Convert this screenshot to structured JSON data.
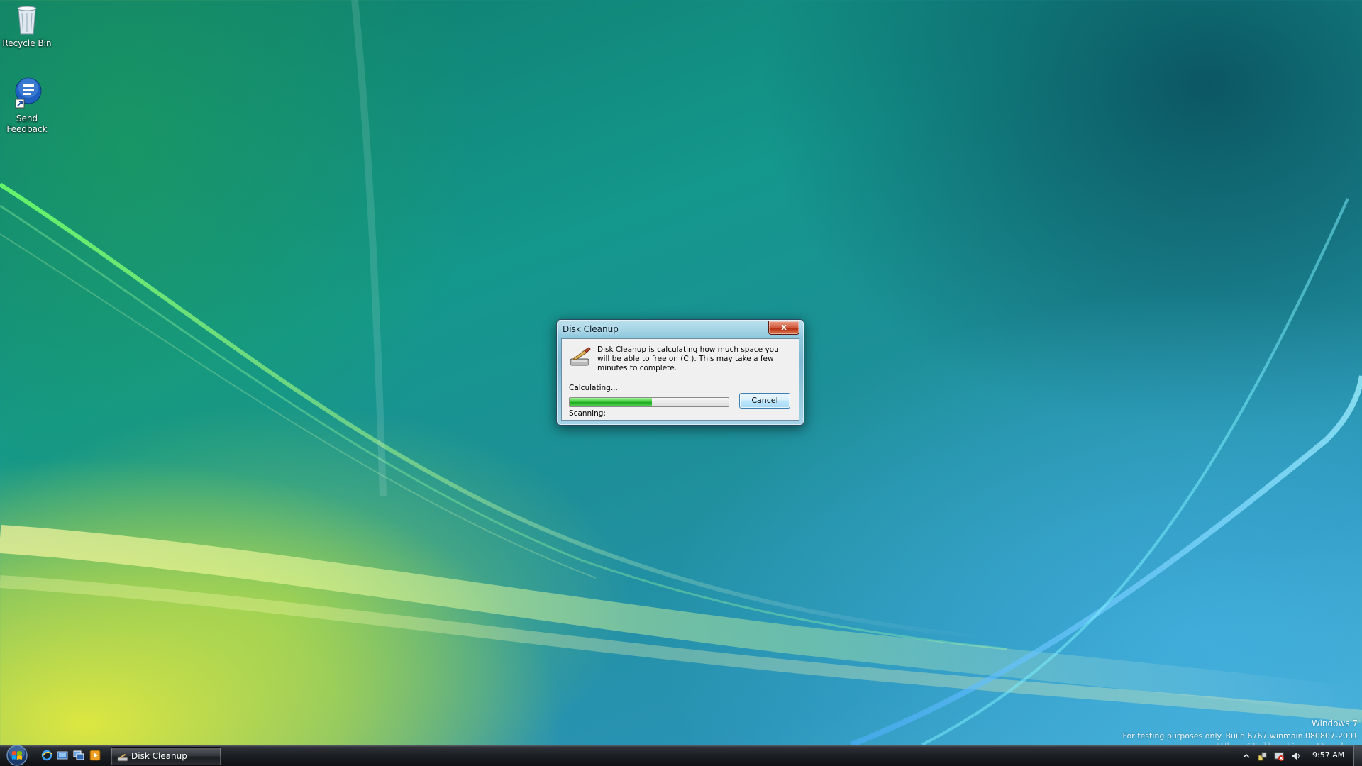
{
  "desktop": {
    "icons": [
      {
        "name": "recycle-bin",
        "label": "Recycle Bin"
      },
      {
        "name": "send-feedback",
        "label": "Send Feedback"
      }
    ]
  },
  "dialog": {
    "title": "Disk Cleanup",
    "close_glyph": "x",
    "message": "Disk Cleanup is calculating how much space you will be able to free on  (C:). This may take a few minutes to complete.",
    "status_label": "Calculating...",
    "progress": 0.52,
    "cancel_label": "Cancel",
    "scanning_label": "Scanning:"
  },
  "watermark": {
    "os_name": "Windows 7",
    "build_line": "For testing purposes only. Build 6767.winmain.080807-2001",
    "overlay_text": "The Collection Book"
  },
  "taskbar": {
    "quick_launch": [
      "internet-explorer-icon",
      "show-desktop-icon",
      "switch-windows-icon",
      "media-player-icon"
    ],
    "active_task": {
      "label": "Disk Cleanup",
      "icon": "disk-cleanup-icon"
    },
    "tray_icons": [
      "show-hidden-icons-chevron",
      "network-icon",
      "action-center-icon",
      "volume-icon"
    ],
    "clock": "9:57 AM"
  },
  "colors": {
    "progress_green": "#3ec83a",
    "close_red": "#c9431f",
    "dialog_frame": "#8cc7dd"
  }
}
